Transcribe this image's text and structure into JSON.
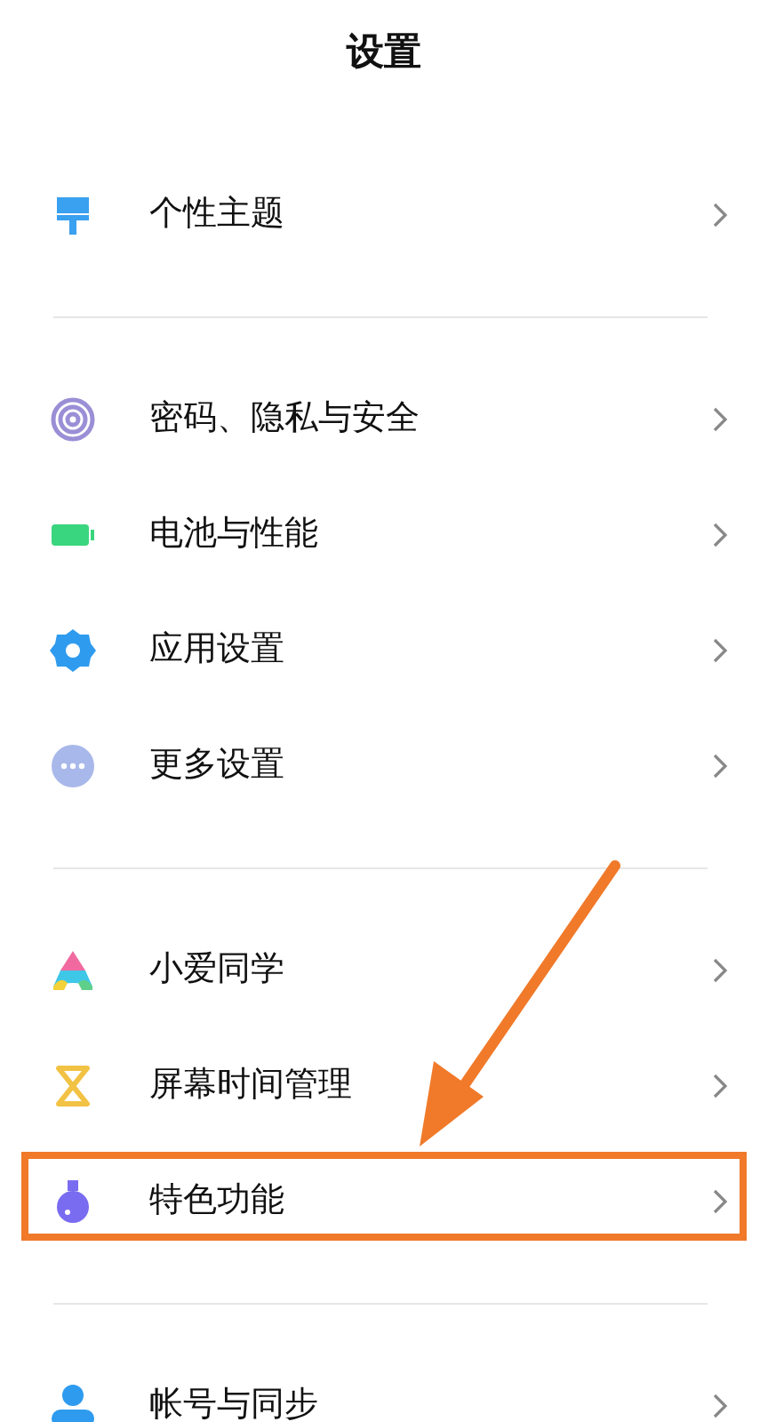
{
  "header": {
    "title": "设置"
  },
  "groups": [
    {
      "items": [
        {
          "kind": "brush",
          "label": "个性主题",
          "highlighted": false
        }
      ]
    },
    {
      "items": [
        {
          "kind": "fingerprint",
          "label": "密码、隐私与安全",
          "highlighted": false
        },
        {
          "kind": "battery",
          "label": "电池与性能",
          "highlighted": false
        },
        {
          "kind": "gear",
          "label": "应用设置",
          "highlighted": false
        },
        {
          "kind": "dots",
          "label": "更多设置",
          "highlighted": false
        }
      ]
    },
    {
      "items": [
        {
          "kind": "assistant",
          "label": "小爱同学",
          "highlighted": false
        },
        {
          "kind": "hourglass",
          "label": "屏幕时间管理",
          "highlighted": false
        },
        {
          "kind": "flask",
          "label": "特色功能",
          "highlighted": true
        }
      ]
    },
    {
      "items": [
        {
          "kind": "person",
          "label": "帐号与同步",
          "highlighted": false
        }
      ]
    }
  ]
}
